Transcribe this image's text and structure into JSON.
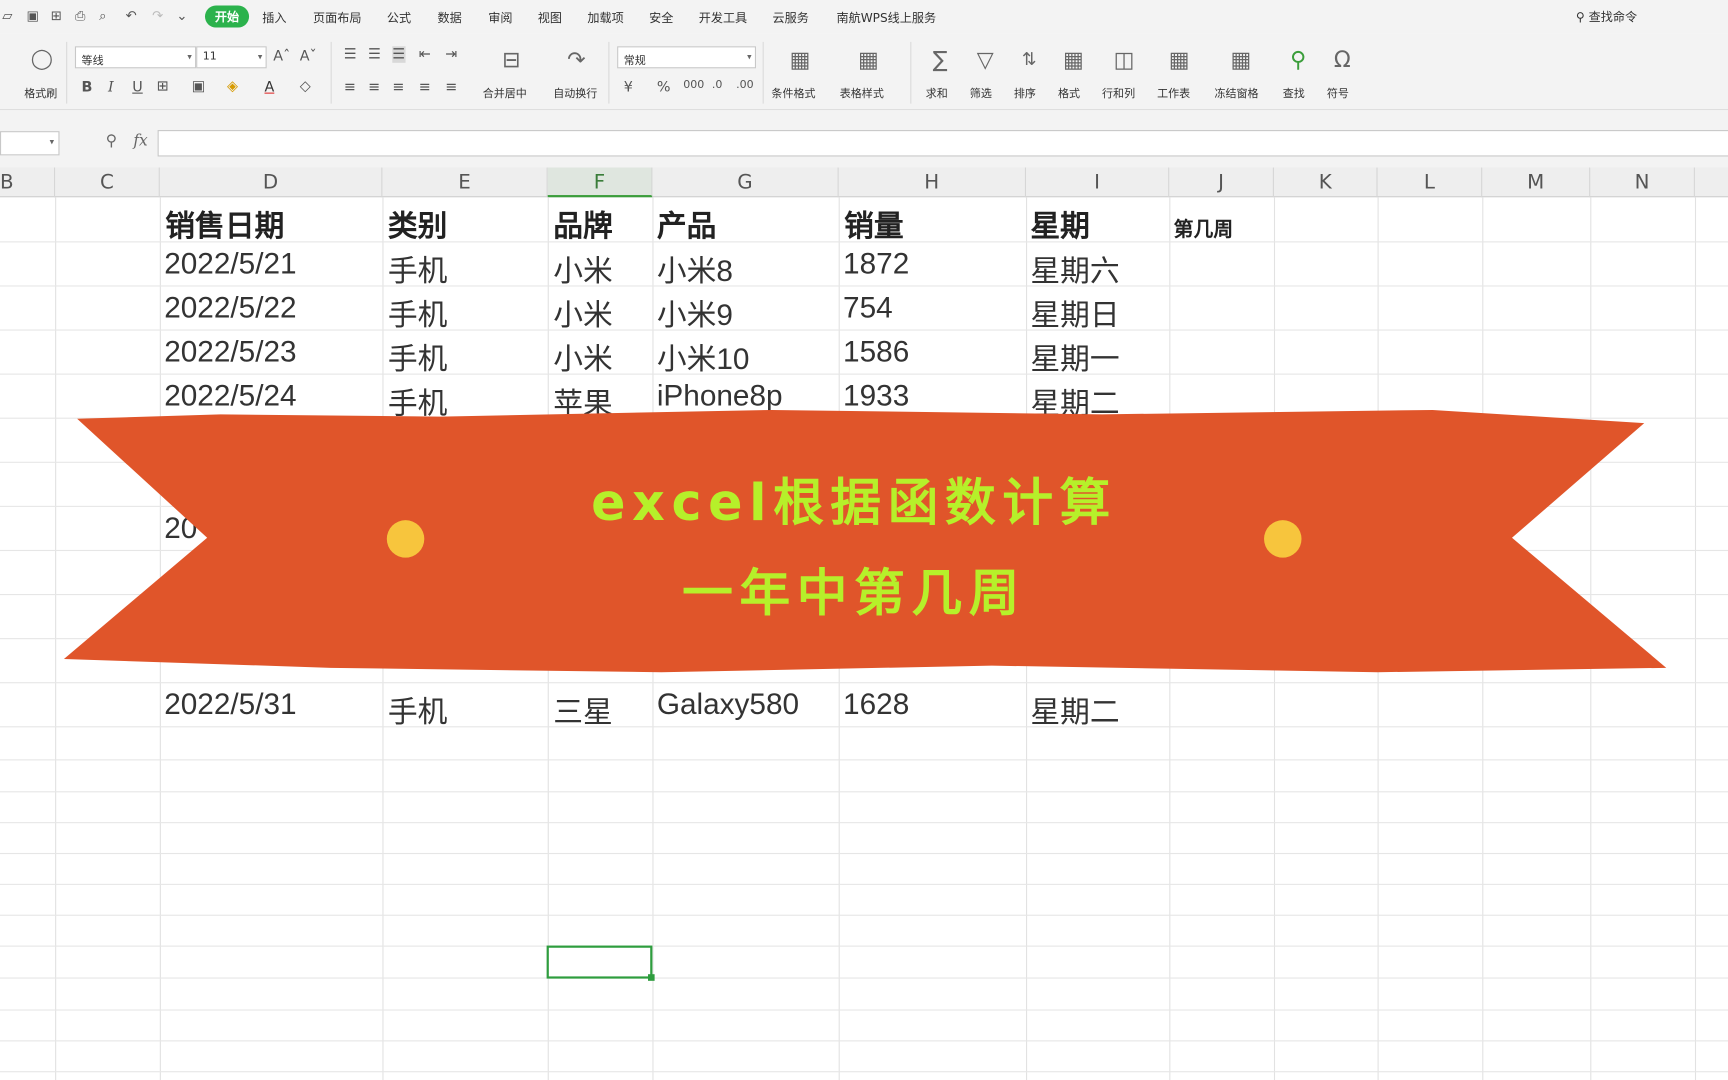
{
  "quick_access": [
    "▱",
    "▣",
    "⊞",
    "⎙",
    "⌕",
    "↶",
    "↷",
    "⌄"
  ],
  "menu_tabs": [
    {
      "label": "开始",
      "active": true
    },
    {
      "label": "插入"
    },
    {
      "label": "页面布局"
    },
    {
      "label": "公式"
    },
    {
      "label": "数据"
    },
    {
      "label": "审阅"
    },
    {
      "label": "视图"
    },
    {
      "label": "加载项"
    },
    {
      "label": "安全"
    },
    {
      "label": "开发工具"
    },
    {
      "label": "云服务"
    },
    {
      "label": "南航WPS线上服务"
    }
  ],
  "search_command": "查找命令",
  "toolbar": {
    "format_painter": "格式刷",
    "font_name": "等线",
    "font_size": "11",
    "number_format": "常规",
    "merge_center": "合并居中",
    "wrap_text": "自动换行",
    "conditional_format": "条件格式",
    "table_style": "表格样式",
    "sum": "求和",
    "filter": "筛选",
    "sort": "排序",
    "format": "格式",
    "row_col": "行和列",
    "worksheet": "工作表",
    "freeze": "冻结窗格",
    "find": "查找",
    "symbol": "符号"
  },
  "formula_bar": {
    "fx": "fx",
    "content": ""
  },
  "column_headers": [
    "B",
    "C",
    "D",
    "E",
    "F",
    "G",
    "H",
    "I",
    "J",
    "K",
    "L",
    "M",
    "N"
  ],
  "selected_column": "F",
  "table": {
    "headers": [
      "销售日期",
      "类别",
      "品牌",
      "产品",
      "销量",
      "星期"
    ],
    "extra_header": "第几周",
    "rows": [
      [
        "2022/5/21",
        "手机",
        "小米",
        "小米8",
        "1872",
        "星期六"
      ],
      [
        "2022/5/22",
        "手机",
        "小米",
        "小米9",
        "754",
        "星期日"
      ],
      [
        "2022/5/23",
        "手机",
        "小米",
        "小米10",
        "1586",
        "星期一"
      ],
      [
        "2022/5/24",
        "手机",
        "苹果",
        "iPhone8p",
        "1933",
        "星期二"
      ]
    ],
    "partial_date": "20",
    "last_row": [
      "2022/5/31",
      "手机",
      "三星",
      "Galaxy580",
      "1628",
      "星期二"
    ]
  },
  "banner": {
    "line1": "excel根据函数计算",
    "line2": "一年中第几周",
    "color": "#e0552a",
    "text_color": "#b6f02a",
    "dot_color": "#f7c53d"
  }
}
